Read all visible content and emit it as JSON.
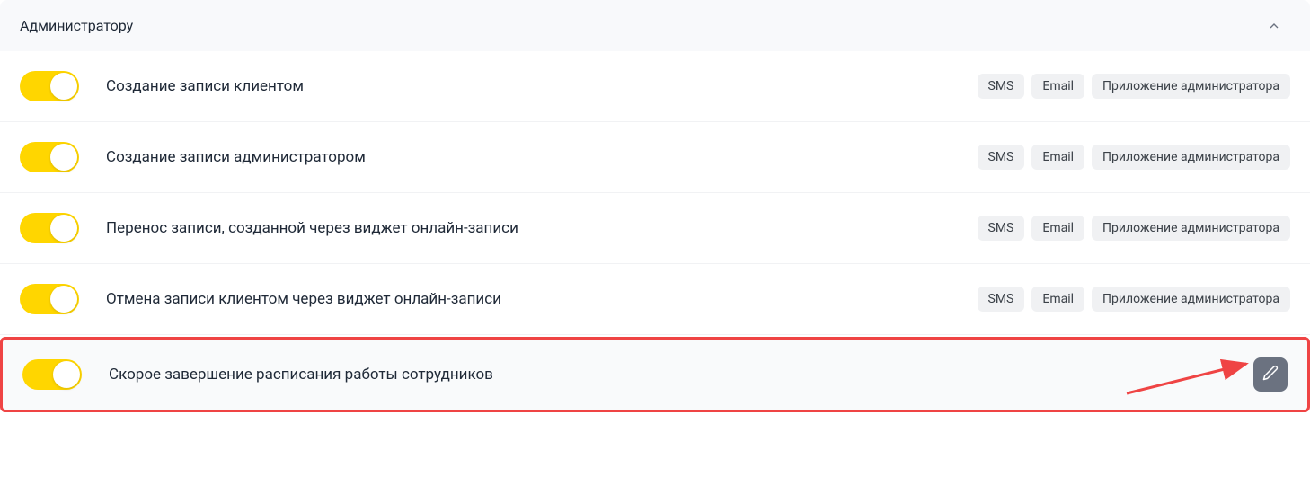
{
  "section": {
    "title": "Администратору"
  },
  "rows": [
    {
      "label": "Создание записи клиентом",
      "badges": [
        "SMS",
        "Email",
        "Приложение администратора"
      ]
    },
    {
      "label": "Создание записи администратором",
      "badges": [
        "SMS",
        "Email",
        "Приложение администратора"
      ]
    },
    {
      "label": "Перенос записи, созданной через виджет онлайн-записи",
      "badges": [
        "SMS",
        "Email",
        "Приложение администратора"
      ]
    },
    {
      "label": "Отмена записи клиентом через виджет онлайн-записи",
      "badges": [
        "SMS",
        "Email",
        "Приложение администратора"
      ]
    }
  ],
  "highlighted": {
    "label": "Скорое завершение расписания работы сотрудников"
  }
}
